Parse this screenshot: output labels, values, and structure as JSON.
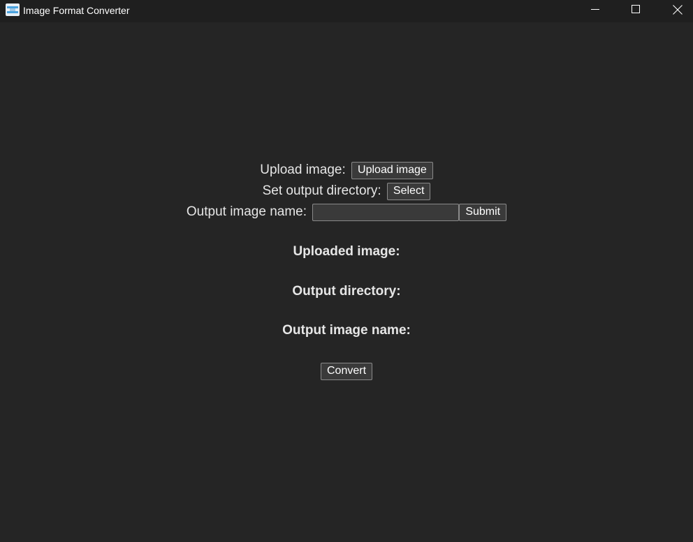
{
  "window": {
    "title": "Image Format Converter",
    "icon": "image-converter-icon",
    "controls": [
      "minimize-icon",
      "maximize-icon",
      "close-icon"
    ]
  },
  "form": {
    "upload_label": "Upload image:",
    "upload_button": "Upload image",
    "output_dir_label": "Set output directory:",
    "select_button": "Select",
    "output_name_label": "Output image name:",
    "output_name_value": "",
    "submit_button": "Submit"
  },
  "status": {
    "uploaded_image_label": "Uploaded image:",
    "output_directory_label": "Output directory:",
    "output_image_name_label": "Output image name:"
  },
  "actions": {
    "convert_button": "Convert"
  },
  "colors": {
    "background": "#252525",
    "titlebar": "#1f1f1f",
    "button_bg": "#3a3a3a",
    "button_border": "#8a8a8a",
    "text": "#e6e6e6"
  }
}
